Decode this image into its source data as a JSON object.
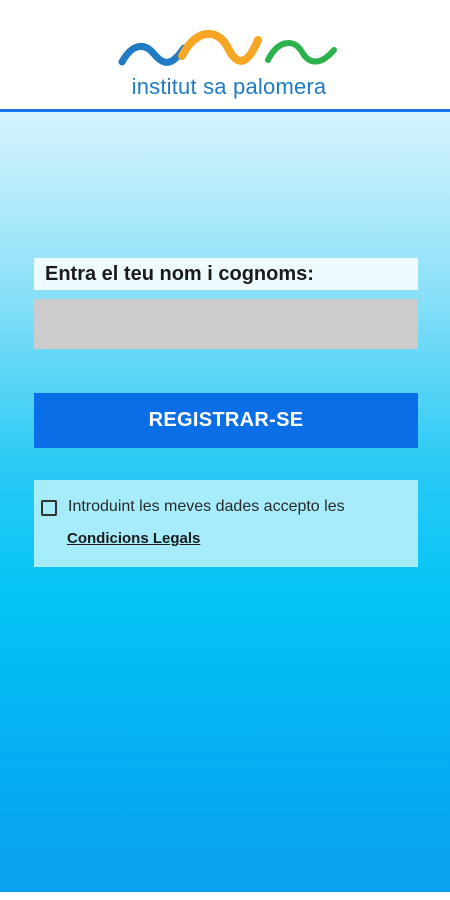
{
  "header": {
    "logo_text": "institut sa palomera",
    "colors": {
      "wave_blue": "#1f7cc4",
      "wave_orange": "#f6a623",
      "wave_green": "#2bb24c",
      "border": "#1a73e8"
    }
  },
  "form": {
    "name_label": "Entra el teu nom i cognoms:",
    "name_value": "",
    "register_label": "REGISTRAR-SE",
    "terms_checked": false,
    "terms_text": "Introduint les meves dades accepto les",
    "terms_link": "Condicions Legals"
  },
  "colors": {
    "button": "#0a6ee6",
    "input": "#cccccc",
    "terms_box": "#a6ecfa"
  }
}
